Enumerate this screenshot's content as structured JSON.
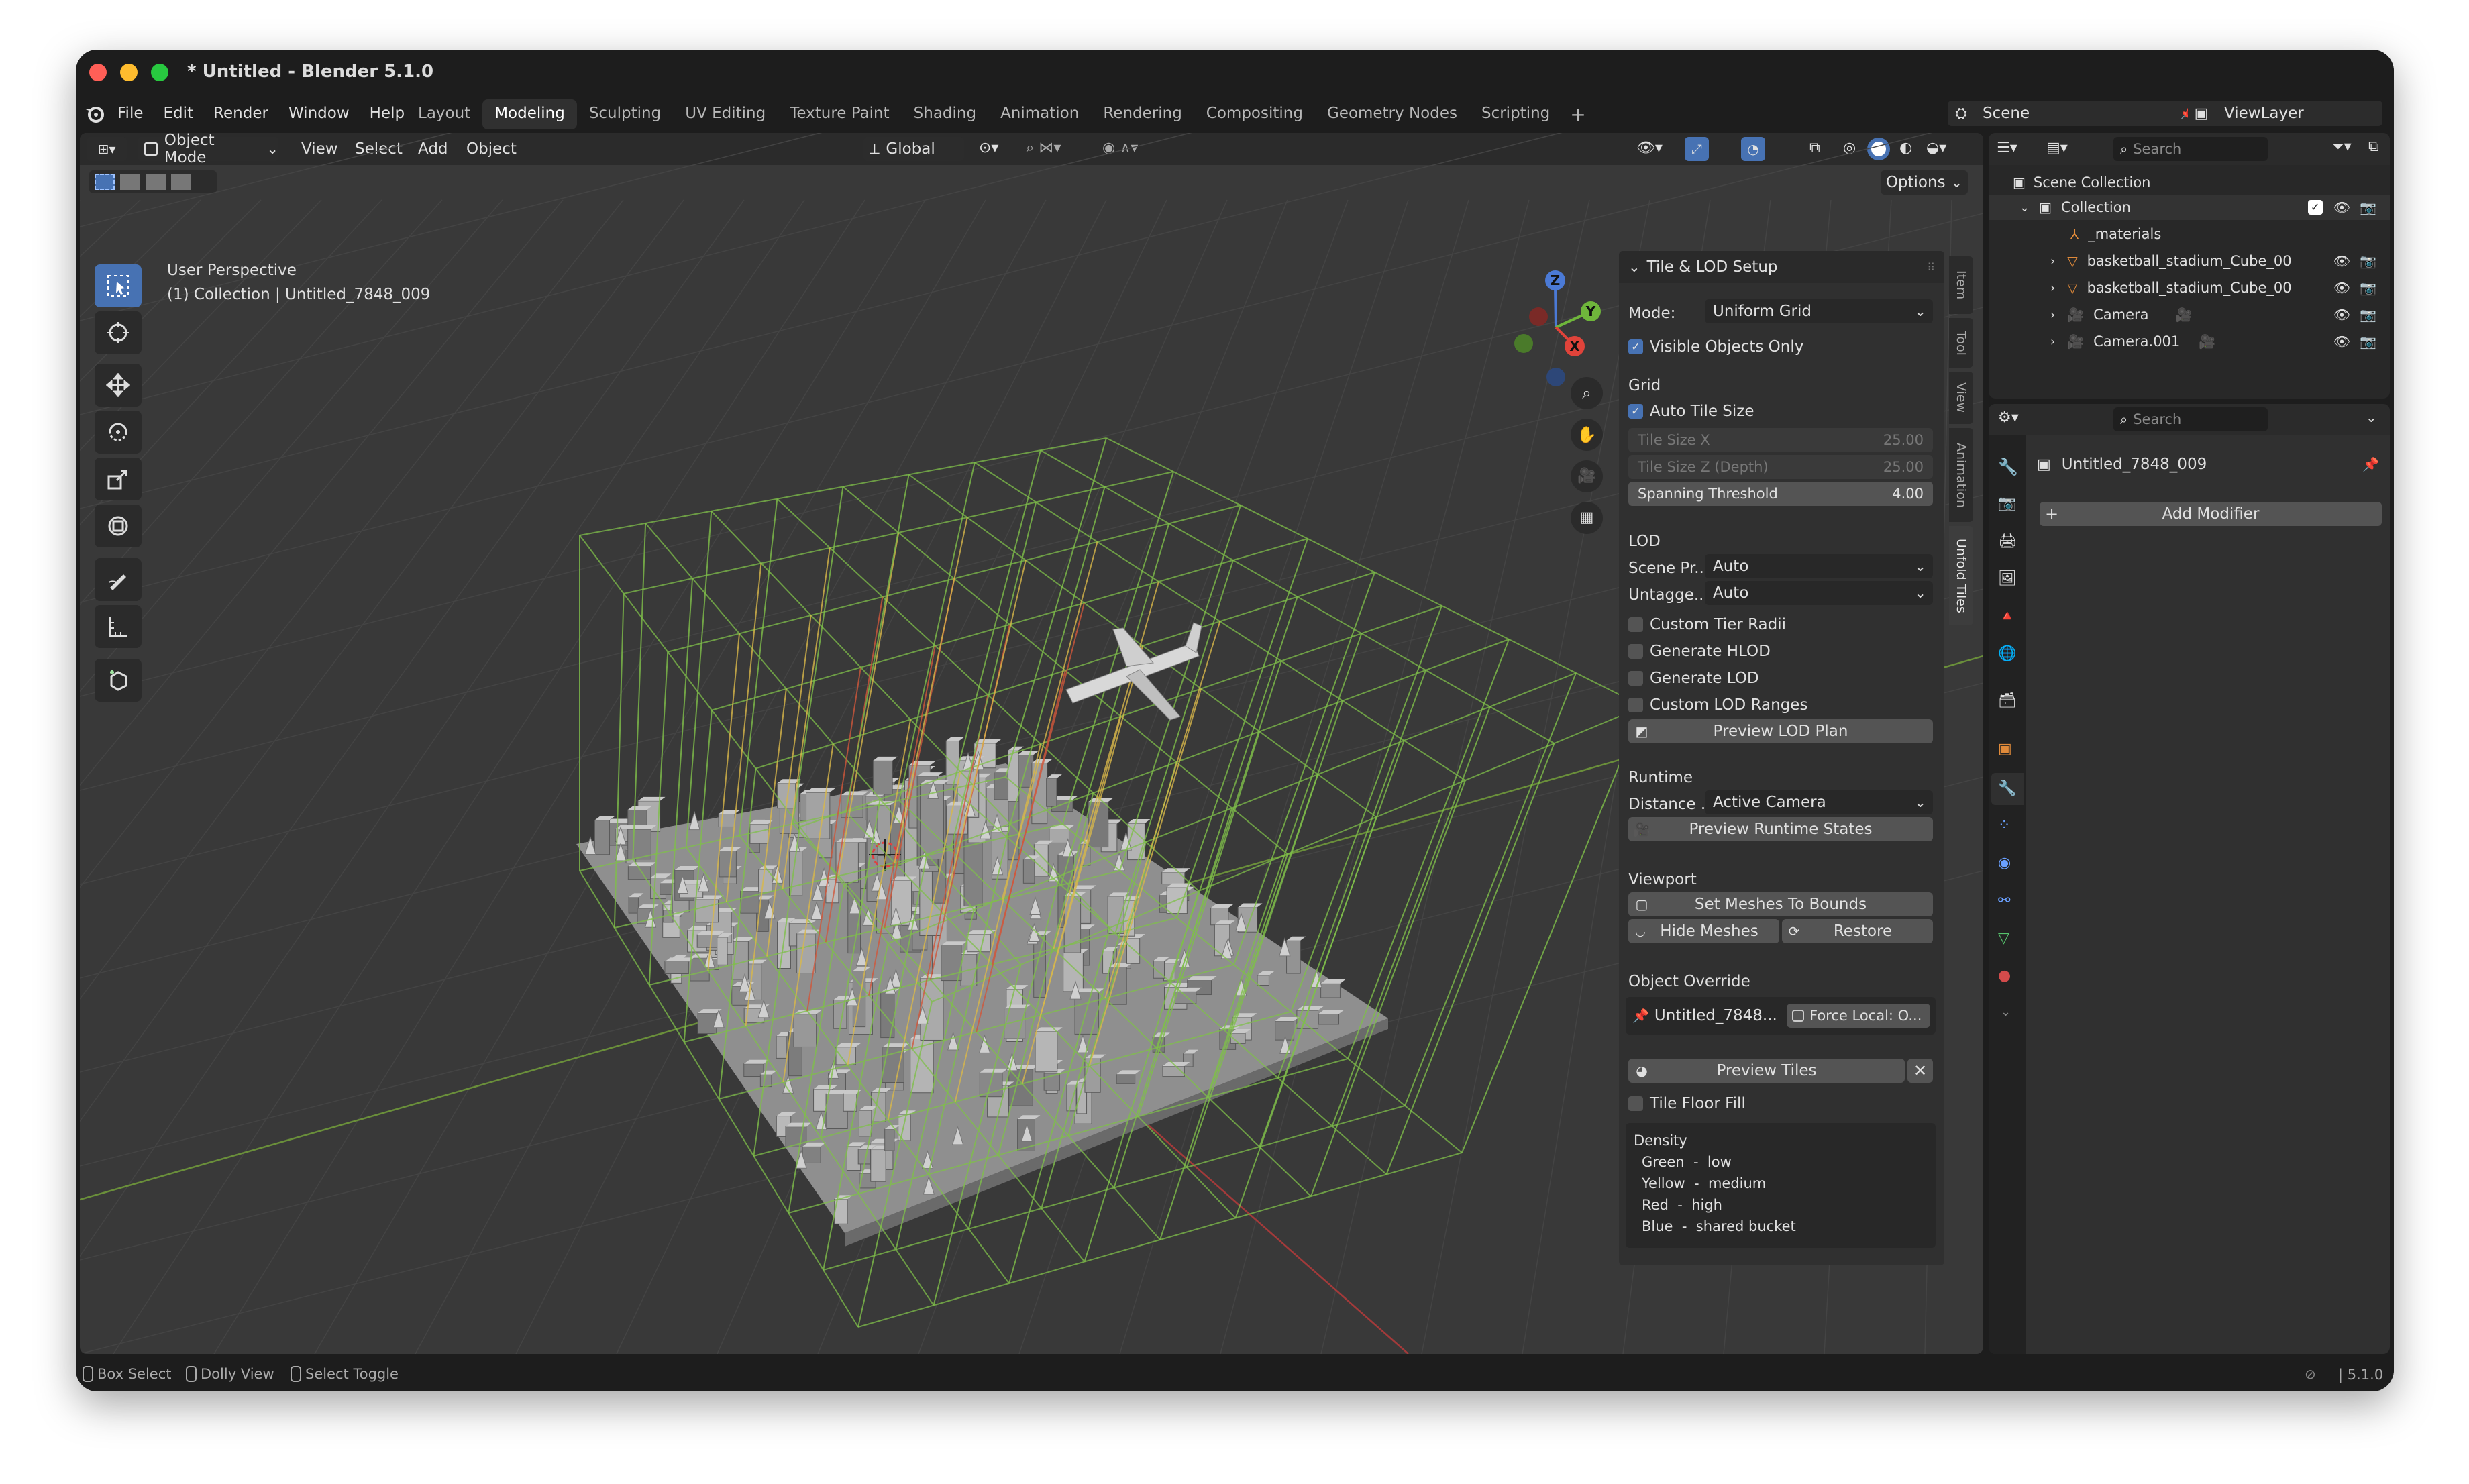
{
  "window": {
    "title": "* Untitled - Blender 5.1.0"
  },
  "menu": [
    "File",
    "Edit",
    "Render",
    "Window",
    "Help"
  ],
  "workspaces": [
    "Layout",
    "Modeling",
    "Sculpting",
    "UV Editing",
    "Texture Paint",
    "Shading",
    "Animation",
    "Rendering",
    "Compositing",
    "Geometry Nodes",
    "Scripting"
  ],
  "active_workspace": "Modeling",
  "scene": {
    "label": "Scene",
    "viewlayer": "ViewLayer"
  },
  "viewport": {
    "mode": "Object Mode",
    "menus": [
      "View",
      "Select",
      "Add",
      "Object"
    ],
    "transform_orientation": "Global",
    "options": "Options",
    "overlay_title": "User Perspective",
    "overlay_sub": "(1) Collection | Untitled_7848_009",
    "gizmo_axes": [
      "Z",
      "Y",
      "X"
    ]
  },
  "n_panel": {
    "tabs": [
      "Item",
      "Tool",
      "View",
      "Animation",
      "Unfold Tiles"
    ],
    "header": "Tile & LOD Setup",
    "mode_label": "Mode:",
    "mode_value": "Uniform Grid",
    "visible_only": "Visible Objects Only",
    "grid_title": "Grid",
    "auto_tile": "Auto Tile Size",
    "tile_x_label": "Tile Size X",
    "tile_x": "25.00",
    "tile_z_label": "Tile Size Z (Depth)",
    "tile_z": "25.00",
    "spanning_label": "Spanning Threshold",
    "spanning": "4.00",
    "lod_title": "LOD",
    "scene_pr_label": "Scene Pr...",
    "scene_pr": "Auto",
    "untagge_label": "Untagge...",
    "untagge": "Auto",
    "custom_tier": "Custom Tier Radii",
    "gen_hlod": "Generate HLOD",
    "gen_lod": "Generate LOD",
    "custom_lod": "Custom LOD Ranges",
    "preview_lod": "Preview LOD Plan",
    "runtime_title": "Runtime",
    "distance_label": "Distance ...",
    "distance": "Active Camera",
    "preview_runtime": "Preview Runtime States",
    "viewport_title": "Viewport",
    "set_meshes": "Set Meshes To Bounds",
    "hide_meshes": "Hide Meshes",
    "restore": "Restore",
    "override_title": "Object Override",
    "override_obj": "Untitled_7848...",
    "force_local": "Force Local: O...",
    "preview_tiles": "Preview Tiles",
    "tile_floor": "Tile Floor Fill",
    "density_title": "Density",
    "density": [
      {
        "color": "Green",
        "level": "low"
      },
      {
        "color": "Yellow",
        "level": "medium"
      },
      {
        "color": "Red",
        "level": "high"
      },
      {
        "color": "Blue",
        "level": "shared bucket"
      }
    ]
  },
  "outliner": {
    "search": "Search",
    "root": "Scene Collection",
    "collection": "Collection",
    "items": [
      "_materials",
      "basketball_stadium_Cube_00",
      "basketball_stadium_Cube_00",
      "Camera",
      "Camera.001"
    ]
  },
  "properties": {
    "search": "Search",
    "object": "Untitled_7848_009",
    "add_modifier": "Add Modifier"
  },
  "status": {
    "items": [
      "Box Select",
      "Dolly View",
      "Select Toggle"
    ],
    "version": "5.1.0"
  },
  "colors": {
    "accent": "#4772b3",
    "grid_green": "#7fbf4a",
    "grid_yellow": "#d9b84a",
    "grid_red": "#d1573b",
    "header_bg": "#2b2b2b",
    "viewport_bg": "#393939"
  }
}
